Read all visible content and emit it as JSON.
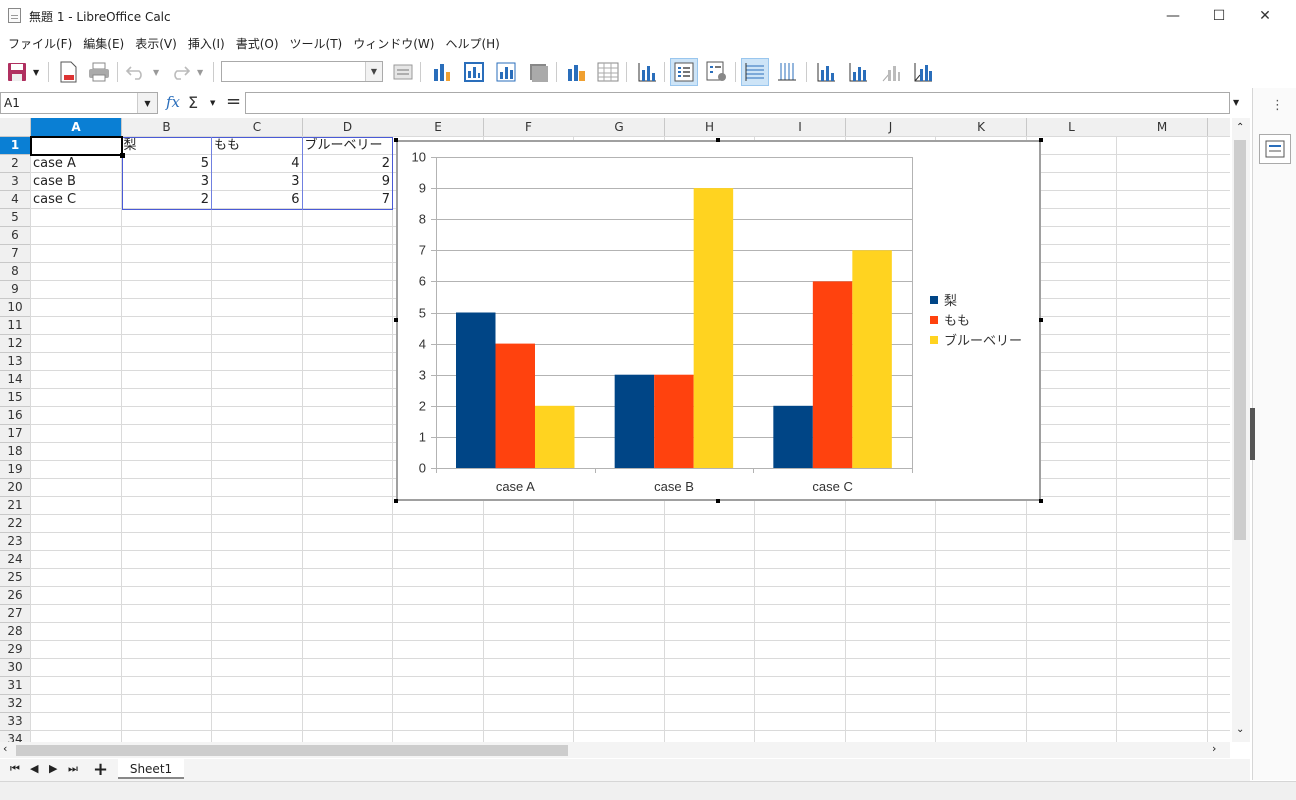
{
  "window": {
    "title": "無題 1 - LibreOffice Calc",
    "controls": [
      "—",
      "☐",
      "✕"
    ]
  },
  "menu": [
    "ファイル(F)",
    "編集(E)",
    "表示(V)",
    "挿入(I)",
    "書式(O)",
    "ツール(T)",
    "ウィンドウ(W)",
    "ヘルプ(H)"
  ],
  "formula_bar": {
    "name_box": "A1",
    "fx": "fx",
    "sum": "Σ",
    "equals": "=",
    "formula": ""
  },
  "grid": {
    "columns": [
      "A",
      "B",
      "C",
      "D",
      "E",
      "F",
      "G",
      "H",
      "I",
      "J",
      "K",
      "L",
      "M"
    ],
    "selected_column": "A",
    "rows": [
      "1",
      "2",
      "3",
      "4",
      "5",
      "6",
      "7",
      "8",
      "9",
      "10",
      "11",
      "12",
      "13",
      "14",
      "15",
      "16",
      "17",
      "18",
      "19",
      "20",
      "21",
      "22",
      "23",
      "24",
      "25",
      "26",
      "27",
      "28",
      "29",
      "30",
      "31",
      "32",
      "33",
      "34"
    ],
    "selected_row": "1",
    "cells": [
      [
        "",
        "梨",
        "もも",
        "ブルーベリー"
      ],
      [
        "case A",
        "5",
        "4",
        "2"
      ],
      [
        "case B",
        "3",
        "3",
        "9"
      ],
      [
        "case C",
        "2",
        "6",
        "7"
      ]
    ]
  },
  "chart_data": {
    "type": "bar",
    "categories": [
      "case A",
      "case B",
      "case C"
    ],
    "series": [
      {
        "name": "梨",
        "values": [
          5,
          3,
          2
        ],
        "color": "#004586"
      },
      {
        "name": "もも",
        "values": [
          4,
          3,
          6
        ],
        "color": "#ff420e"
      },
      {
        "name": "ブルーベリー",
        "values": [
          2,
          9,
          7
        ],
        "color": "#ffd320"
      }
    ],
    "ylim": [
      0,
      10
    ],
    "yticks": [
      "0",
      "1",
      "2",
      "3",
      "4",
      "5",
      "6",
      "7",
      "8",
      "9",
      "10"
    ],
    "grid": true,
    "legend": "right"
  },
  "sheets": {
    "tabs": [
      "Sheet1"
    ],
    "add": "+"
  },
  "colors": {
    "selection": "#0a7fd4",
    "range_border": "#4a5ad6"
  }
}
